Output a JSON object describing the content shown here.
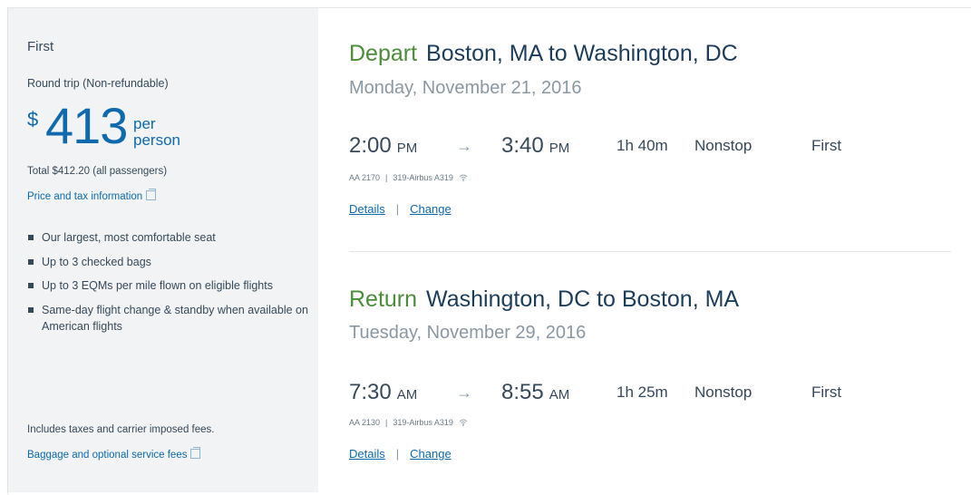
{
  "summary": {
    "fare_name": "First",
    "trip_type": "Round trip (Non-refundable)",
    "currency_symbol": "$",
    "price": "413",
    "per": "per",
    "person": "person",
    "total": "Total $412.20 (all passengers)",
    "price_info_link": "Price and tax information",
    "benefits": [
      "Our largest, most comfortable seat",
      "Up to 3 checked bags",
      "Up to 3 EQMs per mile flown on eligible flights",
      "Same-day flight change & standby when available on American flights"
    ],
    "fees_note": "Includes taxes and carrier imposed fees.",
    "fees_link": "Baggage and optional service fees"
  },
  "segments": [
    {
      "direction": "Depart",
      "route": "Boston, MA to Washington, DC",
      "date": "Monday, November 21, 2016",
      "dep_time": "2:00",
      "dep_ampm": "PM",
      "arrow": "→",
      "arr_time": "3:40",
      "arr_ampm": "PM",
      "duration": "1h 40m",
      "stops": "Nonstop",
      "cabin": "First",
      "flight_number": "AA 2170",
      "aircraft": "319-Airbus A319",
      "details_label": "Details",
      "change_label": "Change"
    },
    {
      "direction": "Return",
      "route": "Washington, DC to Boston, MA",
      "date": "Tuesday, November 29, 2016",
      "dep_time": "7:30",
      "dep_ampm": "AM",
      "arrow": "→",
      "arr_time": "8:55",
      "arr_ampm": "AM",
      "duration": "1h 25m",
      "stops": "Nonstop",
      "cabin": "First",
      "flight_number": "AA 2130",
      "aircraft": "319-Airbus A319",
      "details_label": "Details",
      "change_label": "Change"
    }
  ],
  "colors": {
    "accent_blue": "#0e6aad",
    "direction_green": "#4c8d3a",
    "panel_bg": "#f1f3f4"
  }
}
